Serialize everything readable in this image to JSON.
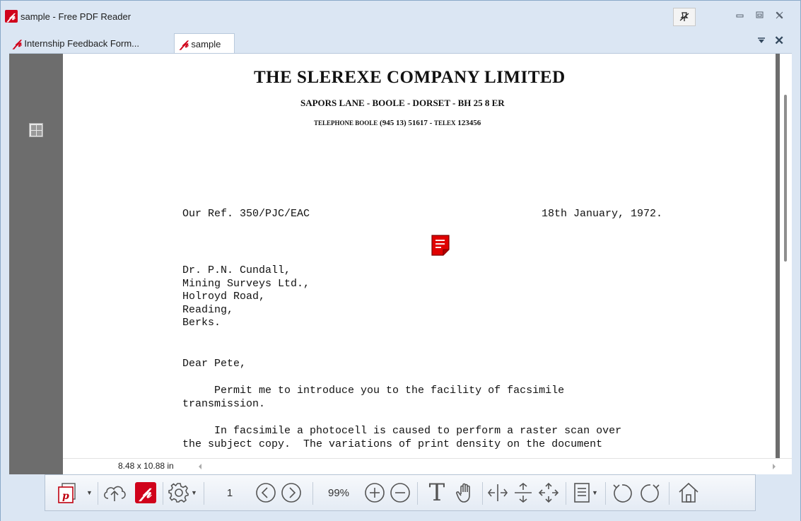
{
  "window": {
    "title": "sample - Free PDF Reader",
    "app_icon_glyph": "𝓅",
    "pin_icon": "pin-off-icon",
    "controls": [
      "minimize",
      "restore",
      "close"
    ]
  },
  "tabs": [
    {
      "label": "Internship Feedback Form...",
      "active": false
    },
    {
      "label": "sample",
      "active": true
    }
  ],
  "tab_bar": {
    "menu_glyph": "▾",
    "close_glyph": "✕"
  },
  "document": {
    "company": "THE SLEREXE COMPANY LIMITED",
    "address": "SAPORS LANE - BOOLE - DORSET - BH 25 8 ER",
    "phone_prefix": "TELEPHONE BOOLE",
    "phone_number": "(945 13) 51617",
    "telex_label": "TELEX",
    "telex_number": "123456",
    "our_ref": "Our Ref. 350/PJC/EAC",
    "date": "18th January, 1972.",
    "recipient": [
      "Dr. P.N. Cundall,",
      "Mining Surveys Ltd.,",
      "Holroyd Road,",
      "Reading,",
      "Berks."
    ],
    "salutation": "Dear Pete,",
    "para1_line1": "     Permit me to introduce you to the facility of facsimile",
    "para1_line2": "transmission.",
    "para2_line1": "     In facsimile a photocell is caused to perform a raster scan over",
    "para2_line2": "the subject copy.  The variations of print density on the document"
  },
  "status": {
    "page_size": "8.48 x 10.88 in"
  },
  "toolbar": {
    "page_number": "1",
    "zoom": "99%",
    "text_tool_glyph": "T"
  },
  "colors": {
    "brand_red": "#d0021b",
    "chrome_blue": "#dbe6f3",
    "viewer_gray": "#6d6d6d"
  }
}
